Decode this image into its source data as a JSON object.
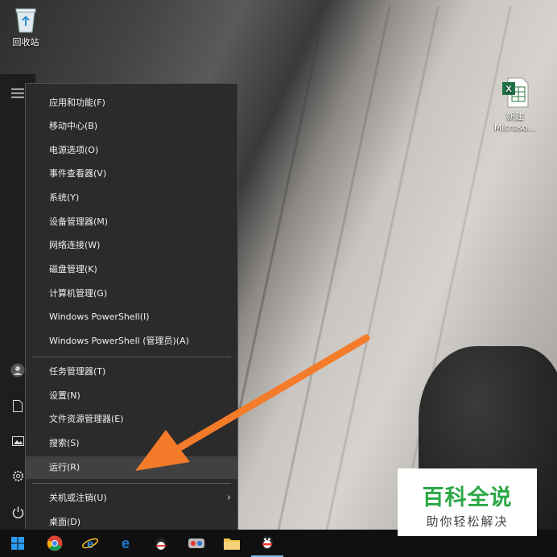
{
  "desktop": {
    "icons": [
      {
        "label": "回收站",
        "icon": "recycle-bin-icon"
      },
      {
        "label_line1": "新建",
        "label_line2": "Microso...",
        "icon": "excel-file-icon"
      }
    ]
  },
  "context_menu": {
    "items": [
      {
        "label": "应用和功能(F)"
      },
      {
        "label": "移动中心(B)"
      },
      {
        "label": "电源选项(O)"
      },
      {
        "label": "事件查看器(V)"
      },
      {
        "label": "系统(Y)"
      },
      {
        "label": "设备管理器(M)"
      },
      {
        "label": "网络连接(W)"
      },
      {
        "label": "磁盘管理(K)"
      },
      {
        "label": "计算机管理(G)"
      },
      {
        "label": "Windows PowerShell(I)"
      },
      {
        "label": "Windows PowerShell (管理员)(A)"
      },
      {
        "label": "任务管理器(T)"
      },
      {
        "label": "设置(N)"
      },
      {
        "label": "文件资源管理器(E)"
      },
      {
        "label": "搜索(S)"
      },
      {
        "label": "运行(R)",
        "highlighted": true
      },
      {
        "label": "关机或注销(U)",
        "has_submenu": true
      },
      {
        "label": "桌面(D)"
      }
    ]
  },
  "start_rail": {
    "icons": [
      "hamburger-icon",
      "user-icon",
      "documents-icon",
      "pictures-icon",
      "settings-icon",
      "power-icon"
    ]
  },
  "taskbar": {
    "icons": [
      "windows-start-icon",
      "chrome-icon",
      "ie-icon",
      "edge-icon",
      "qq-penguin-icon",
      "app-icon",
      "folder-icon",
      "qq-icon"
    ]
  },
  "watermark": {
    "main": "百科全说",
    "sub": "助你轻松解决",
    "color": "#2aa845"
  },
  "colors": {
    "menu_bg": "#2b2b2b",
    "highlight": "#414141",
    "arrow": "#f47b2a",
    "taskbar_bg": "#101010"
  }
}
